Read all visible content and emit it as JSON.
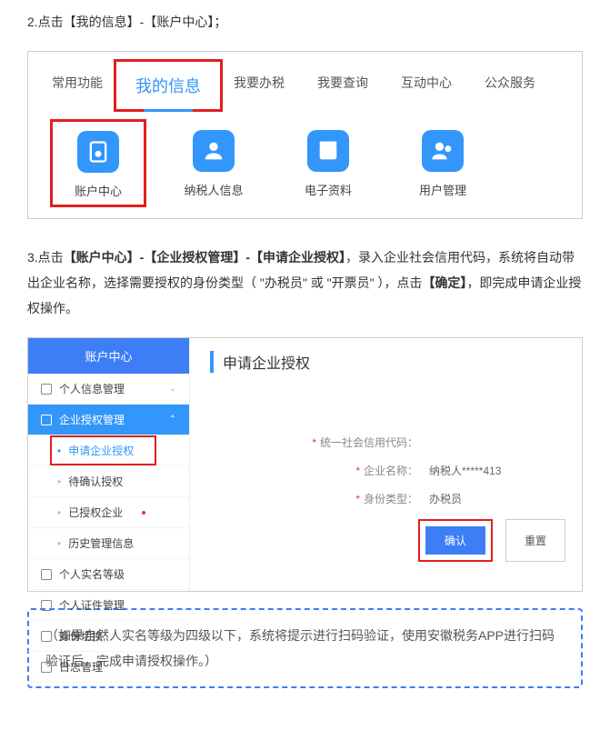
{
  "step2_text": "2.点击【我的信息】-【账户中心】；",
  "tabs": {
    "t0": "常用功能",
    "t1": "我的信息",
    "t2": "我要办税",
    "t3": "我要查询",
    "t4": "互动中心",
    "t5": "公众服务"
  },
  "icons": {
    "i0": "账户中心",
    "i1": "纳税人信息",
    "i2": "电子资料",
    "i3": "用户管理"
  },
  "step3_prefix": "3.点击",
  "step3_b1": "【账户中心】-【企业授权管理】-【申请企业授权】",
  "step3_mid1": "，录入企业社会信用代码，系统将自动带出企业名称，选择需要授权的身份类型（ \"办税员\" 或 \"开票员\" ），点击",
  "step3_b2": "【确定】",
  "step3_tail": "，即完成申请企业授权操作。",
  "sidebar_title": "账户中心",
  "side": {
    "s0": "个人信息管理",
    "s1": "企业授权管理",
    "s1a": "申请企业授权",
    "s1b": "待确认授权",
    "s1c": "已授权企业",
    "s1d": "历史管理信息",
    "s2": "个人实名等级",
    "s3": "个人证件管理",
    "s4": "身份切换",
    "s5": "日志管理"
  },
  "panel_title": "申请企业授权",
  "form": {
    "f0_label": "统一社会信用代码：",
    "f1_label": "企业名称：",
    "f1_value": "纳税人*****413",
    "f2_label": "身份类型：",
    "f2_value": "办税员"
  },
  "btns": {
    "confirm": "确认",
    "reset": "重置"
  },
  "note": "（如果自然人实名等级为四级以下，系统将提示进行扫码验证，使用安徽税务APP进行扫码验证后，完成申请授权操作。）"
}
